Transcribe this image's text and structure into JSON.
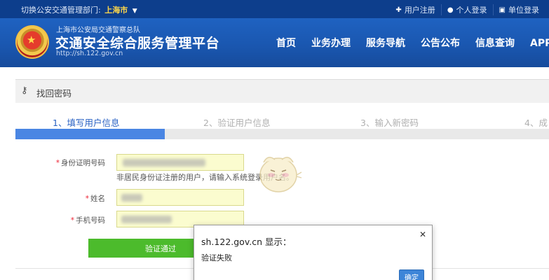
{
  "topbar": {
    "dept_label": "切换公安交通管理部门:",
    "city": "上海市",
    "links": [
      {
        "icon": "plus-icon",
        "label": "用户注册"
      },
      {
        "icon": "user-icon",
        "label": "个人登录"
      },
      {
        "icon": "building-icon",
        "label": "单位登录"
      }
    ]
  },
  "header": {
    "subtitle": "上海市公安局交通警察总队",
    "title": "交通安全综合服务管理平台",
    "url": "http://sh.122.gov.cn",
    "nav": [
      "首页",
      "业务办理",
      "服务导航",
      "公告公布",
      "信息查询",
      "APP下"
    ]
  },
  "page": {
    "title": "找回密码",
    "steps": [
      "1、填写用户信息",
      "2、验证用户信息",
      "3、输入新密码",
      "4、成"
    ],
    "progress_fraction": 0.28
  },
  "form": {
    "id_label": "身份证明号码",
    "id_hint": "非居民身份证注册的用户，请输入系统登录用户名。",
    "name_label": "姓名",
    "phone_label": "手机号码",
    "submit_label": "验证通过"
  },
  "dialog": {
    "title": "sh.122.gov.cn 显示：",
    "message": "验证失败",
    "ok_label": "确定"
  },
  "colors": {
    "topbar": "#0d3e8c",
    "header": "#1a57b0",
    "accent": "#4a86e3",
    "submit": "#4cbb2c",
    "input_bg": "#fbfccf"
  }
}
